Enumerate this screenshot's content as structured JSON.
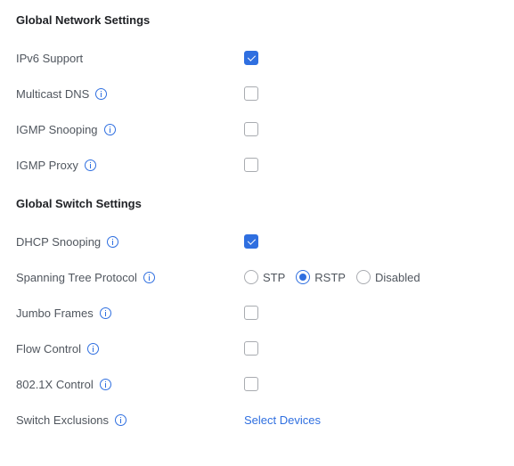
{
  "sections": {
    "network": {
      "title": "Global Network Settings",
      "rows": [
        {
          "label": "IPv6 Support",
          "checked": true
        },
        {
          "label": "Multicast DNS",
          "checked": false
        },
        {
          "label": "IGMP Snooping",
          "checked": false
        },
        {
          "label": "IGMP Proxy",
          "checked": false
        }
      ]
    },
    "switch": {
      "title": "Global Switch Settings",
      "dhcp": {
        "label": "DHCP Snooping",
        "checked": true
      },
      "stp": {
        "label": "Spanning Tree Protocol",
        "options": [
          "STP",
          "RSTP",
          "Disabled"
        ],
        "selected": "RSTP"
      },
      "jumbo": {
        "label": "Jumbo Frames",
        "checked": false
      },
      "flow": {
        "label": "Flow Control",
        "checked": false
      },
      "dot1x": {
        "label": "802.1X Control",
        "checked": false
      },
      "exclusions": {
        "label": "Switch Exclusions",
        "link": "Select Devices"
      }
    }
  },
  "colors": {
    "accent": "#2f6fe0",
    "text": "#50565e",
    "heading": "#212327"
  },
  "icons": {
    "info": "info-circle-icon"
  }
}
